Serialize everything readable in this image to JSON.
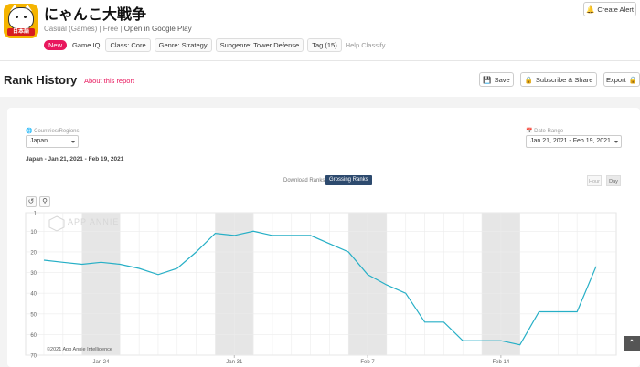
{
  "app": {
    "title": "にゃんこ大戦争",
    "category": "Casual (Games)",
    "price": "Free",
    "store_link": "Open in Google Play",
    "icon_badge": "日本語",
    "tags": {
      "new_badge": "New",
      "game_iq": "Game IQ",
      "class": "Class: Core",
      "genre": "Genre: Strategy",
      "subgenre": "Subgenre: Tower Defense",
      "tag_count": "Tag (15)",
      "help": "Help Classify"
    },
    "create_alert": "Create Alert"
  },
  "report": {
    "title": "Rank History",
    "about": "About this report",
    "save": "Save",
    "subscribe": "Subscribe & Share",
    "export": "Export"
  },
  "filters": {
    "country_label": "Countries/Regions",
    "country_value": "Japan",
    "date_label": "Date Range",
    "date_value": "Jan 21, 2021 - Feb 19, 2021",
    "range_summary": "Japan - Jan 21, 2021 - Feb 19, 2021"
  },
  "rank_toggle": {
    "download": "Download Ranks",
    "grossing": "Grossing Ranks"
  },
  "granularity": {
    "hour": "Hour",
    "day": "Day"
  },
  "watermark": "APP ANNIE",
  "copyright": "©2021 App Annie Intelligence",
  "colors": {
    "line": "#26afc6",
    "accent": "#e8175d",
    "toggle_active": "#2d4a6e"
  },
  "chart_data": {
    "type": "line",
    "title": "",
    "xlabel": "",
    "ylabel": "",
    "y_reversed": true,
    "ylim": [
      1,
      70
    ],
    "y_ticks": [
      1,
      10,
      20,
      30,
      40,
      50,
      60,
      70
    ],
    "x_tick_labels": [
      "Jan 24",
      "Jan 31",
      "Feb 7",
      "Feb 14"
    ],
    "x_tick_days": [
      3,
      10,
      17,
      24
    ],
    "weekend_bands": [
      [
        2,
        4
      ],
      [
        9,
        11
      ],
      [
        16,
        18
      ],
      [
        23,
        25
      ]
    ],
    "grid": true,
    "series": [
      {
        "x": [
          "Jan 21",
          "Jan 22",
          "Jan 23",
          "Jan 24",
          "Jan 25",
          "Jan 26",
          "Jan 27",
          "Jan 28",
          "Jan 29",
          "Jan 30",
          "Jan 31",
          "Feb 1",
          "Feb 2",
          "Feb 3",
          "Feb 4",
          "Feb 5",
          "Feb 6",
          "Feb 7",
          "Feb 8",
          "Feb 9",
          "Feb 10",
          "Feb 11",
          "Feb 12",
          "Feb 13",
          "Feb 14",
          "Feb 15",
          "Feb 16",
          "Feb 17",
          "Feb 18",
          "Feb 19"
        ],
        "y": [
          24,
          25,
          26,
          25,
          26,
          28,
          31,
          28,
          20,
          11,
          12,
          10,
          12,
          12,
          12,
          16,
          20,
          31,
          36,
          40,
          54,
          54,
          63,
          63,
          63,
          65,
          49,
          49,
          49,
          27
        ]
      }
    ]
  }
}
